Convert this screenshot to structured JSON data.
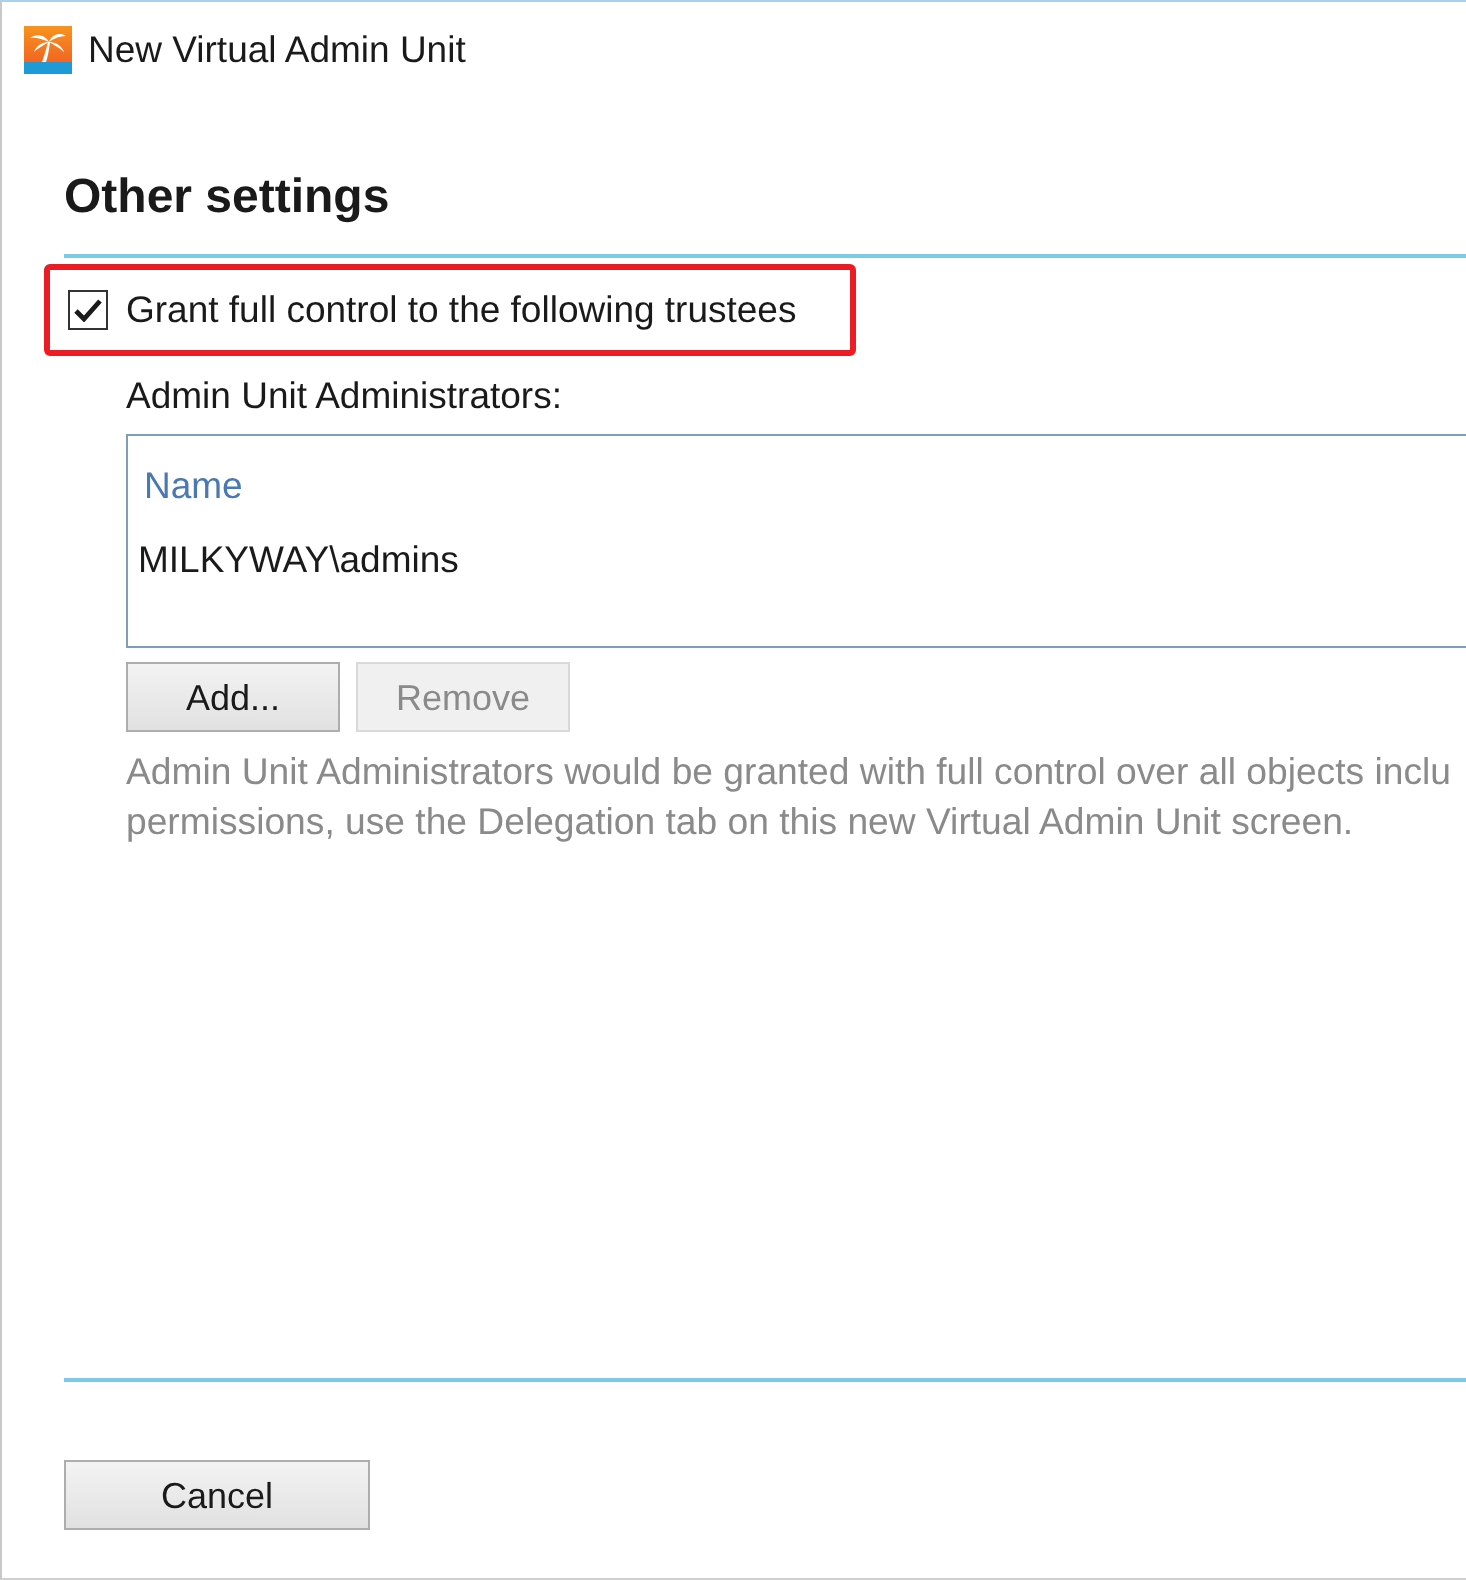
{
  "window": {
    "title": "New Virtual Admin Unit"
  },
  "section": {
    "title": "Other settings"
  },
  "grant_checkbox": {
    "label": "Grant full control to the following trustees",
    "checked": true,
    "highlighted": true
  },
  "administrators": {
    "label": "Admin Unit Administrators:",
    "columns": [
      "Name"
    ],
    "rows": [
      {
        "cells": [
          "MILKYWAY\\admins"
        ],
        "selected": false
      }
    ]
  },
  "buttons": [
    {
      "label": "Add...",
      "disabled": false
    },
    {
      "label": "Remove",
      "disabled": true
    }
  ],
  "help_text": [
    "Admin Unit Administrators would be granted with full control over all objects inclu",
    "permissions, use the Delegation tab on this new Virtual Admin Unit screen."
  ],
  "footer_buttons": [
    {
      "label": "Cancel",
      "disabled": false
    }
  ]
}
